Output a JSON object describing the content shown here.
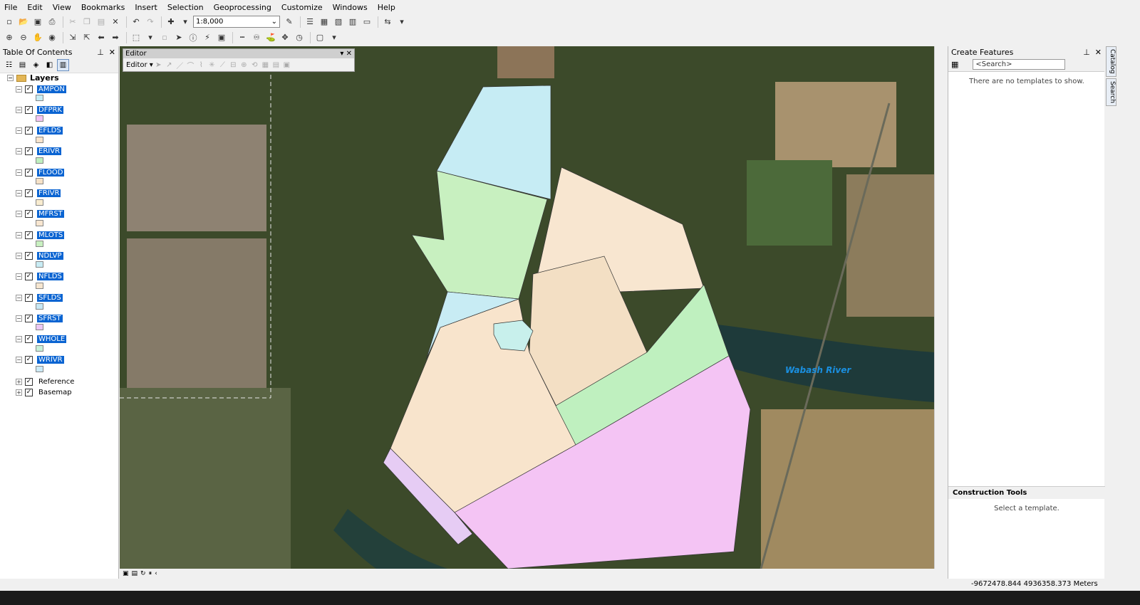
{
  "menu": [
    "File",
    "Edit",
    "View",
    "Bookmarks",
    "Insert",
    "Selection",
    "Geoprocessing",
    "Customize",
    "Windows",
    "Help"
  ],
  "toolbar": {
    "scale": "1:8,000"
  },
  "toc": {
    "title": "Table Of Contents",
    "root": "Layers",
    "layers": [
      {
        "name": "AMPON",
        "color": "#c6ecf4"
      },
      {
        "name": "DFPRK",
        "color": "#f4c4f4"
      },
      {
        "name": "EFLDS",
        "color": "#f8e4cc"
      },
      {
        "name": "ERIVR",
        "color": "#bff0bf"
      },
      {
        "name": "FLOOD",
        "color": "#f6e2c8"
      },
      {
        "name": "FRIVR",
        "color": "#f8ecd0"
      },
      {
        "name": "MFRST",
        "color": "#f8e6d0"
      },
      {
        "name": "MLOTS",
        "color": "#c8f0c0"
      },
      {
        "name": "NDLVP",
        "color": "#c8ecf4"
      },
      {
        "name": "NFLDS",
        "color": "#f6e6d0"
      },
      {
        "name": "SFLDS",
        "color": "#c8e8f4"
      },
      {
        "name": "SFRST",
        "color": "#ecc8f4"
      },
      {
        "name": "WHOLE",
        "color": "#c8f0d8"
      },
      {
        "name": "WRIVR",
        "color": "#cceaf6"
      }
    ],
    "groups": [
      "Reference",
      "Basemap"
    ]
  },
  "editor": {
    "title": "Editor",
    "menu": "Editor"
  },
  "map": {
    "river_label": "Wabash River"
  },
  "create_features": {
    "title": "Create Features",
    "search_placeholder": "<Search>",
    "empty": "There are no templates to show.",
    "construction_title": "Construction Tools",
    "construction_empty": "Select a template."
  },
  "side_tabs": [
    "Catalog",
    "Search"
  ],
  "status": {
    "coords": "-9672478.844  4936358.373 Meters"
  }
}
